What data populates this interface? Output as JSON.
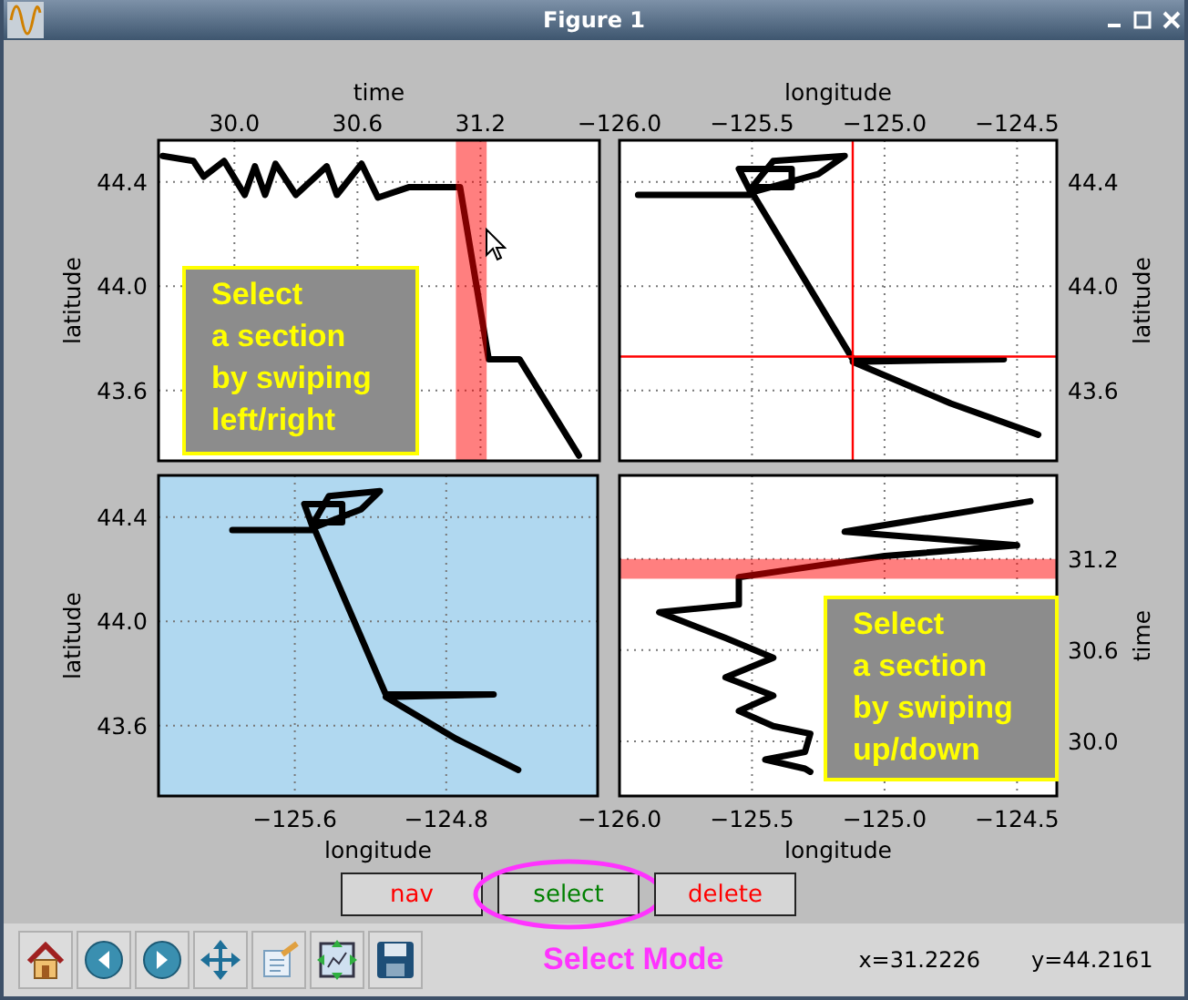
{
  "window": {
    "title": "Figure 1"
  },
  "axes": [
    {
      "highlighted": false,
      "hint": {
        "text": "Select\na section\nby swiping\nleft/right"
      },
      "chart_data": {
        "type": "line",
        "xlabel": "time",
        "ylabel": "latitude",
        "xlim": [
          29.63,
          31.78
        ],
        "ylim": [
          43.33,
          44.56
        ],
        "grid": true,
        "xticks": [
          {
            "value": 30.0,
            "label": "30.0"
          },
          {
            "value": 30.6,
            "label": "30.6"
          },
          {
            "value": 31.2,
            "label": "31.2"
          }
        ],
        "yticks": [
          {
            "value": 43.6,
            "label": "43.6"
          },
          {
            "value": 44.0,
            "label": "44.0"
          },
          {
            "value": 44.4,
            "label": "44.4"
          }
        ],
        "x": [
          29.65,
          29.8,
          29.85,
          29.95,
          30.05,
          30.1,
          30.15,
          30.2,
          30.3,
          30.45,
          30.5,
          30.62,
          30.7,
          30.85,
          31.1,
          31.24,
          31.39,
          31.68
        ],
        "series": [
          {
            "color": "#000000",
            "values": [
              44.5,
              44.48,
              44.42,
              44.48,
              44.35,
              44.46,
              44.35,
              44.47,
              44.35,
              44.46,
              44.35,
              44.47,
              44.34,
              44.38,
              44.38,
              43.72,
              43.72,
              43.35
            ]
          }
        ],
        "bands": [
          {
            "axis": "x",
            "from": 31.08,
            "to": 31.23,
            "color": "#ff0000"
          }
        ]
      }
    },
    {
      "highlighted": false,
      "chart_data": {
        "type": "line",
        "xlabel": "longitude",
        "ylabel": "latitude",
        "xlim": [
          -126.0,
          -124.35
        ],
        "ylim": [
          43.33,
          44.56
        ],
        "grid": true,
        "xticks": [
          {
            "value": -126.0,
            "label": "−126.0"
          },
          {
            "value": -125.5,
            "label": "−125.5"
          },
          {
            "value": -125.0,
            "label": "−125.0"
          },
          {
            "value": -124.5,
            "label": "−124.5"
          }
        ],
        "yticks": [
          {
            "value": 43.6,
            "label": "43.6"
          },
          {
            "value": 44.0,
            "label": "44.0"
          },
          {
            "value": 44.4,
            "label": "44.4"
          }
        ],
        "x": [
          -125.93,
          -125.5,
          -125.55,
          -125.35,
          -125.35,
          -125.5,
          -125.42,
          -125.15,
          -125.25,
          -125.5,
          -125.12,
          -124.55,
          -125.12,
          -124.75,
          -124.42
        ],
        "series": [
          {
            "color": "#000000",
            "values": [
              44.35,
              44.35,
              44.45,
              44.45,
              44.38,
              44.38,
              44.48,
              44.5,
              44.43,
              44.36,
              43.72,
              43.72,
              43.71,
              43.55,
              43.43
            ]
          }
        ],
        "ref_lines": [
          {
            "axis": "x",
            "value": -125.12,
            "color": "#ff0000"
          },
          {
            "axis": "y",
            "value": 43.73,
            "color": "#ff0000"
          }
        ]
      }
    },
    {
      "highlighted": true,
      "chart_data": {
        "type": "line",
        "xlabel": "longitude",
        "ylabel": "latitude",
        "xlim": [
          -126.32,
          -124.0
        ],
        "ylim": [
          43.33,
          44.56
        ],
        "grid": true,
        "xticks": [
          {
            "value": -125.6,
            "label": "−125.6"
          },
          {
            "value": -124.8,
            "label": "−124.8"
          }
        ],
        "yticks": [
          {
            "value": 43.6,
            "label": "43.6"
          },
          {
            "value": 44.0,
            "label": "44.0"
          },
          {
            "value": 44.4,
            "label": "44.4"
          }
        ],
        "x": [
          -125.93,
          -125.5,
          -125.55,
          -125.35,
          -125.35,
          -125.5,
          -125.42,
          -125.15,
          -125.25,
          -125.5,
          -125.12,
          -124.55,
          -125.12,
          -124.75,
          -124.42
        ],
        "series": [
          {
            "color": "#000000",
            "values": [
              44.35,
              44.35,
              44.45,
              44.45,
              44.38,
              44.38,
              44.48,
              44.5,
              44.43,
              44.36,
              43.72,
              43.72,
              43.71,
              43.55,
              43.43
            ]
          }
        ]
      }
    },
    {
      "highlighted": false,
      "hint": {
        "text": "Select\na section\nby swiping\nup/down"
      },
      "chart_data": {
        "type": "line",
        "xlabel": "longitude",
        "ylabel": "time",
        "xlim": [
          -126.0,
          -124.35
        ],
        "ylim": [
          29.64,
          31.75
        ],
        "grid": true,
        "xticks": [
          {
            "value": -126.0,
            "label": "−126.0"
          },
          {
            "value": -125.5,
            "label": "−125.5"
          },
          {
            "value": -125.0,
            "label": "−125.0"
          },
          {
            "value": -124.5,
            "label": "−124.5"
          }
        ],
        "yticks": [
          {
            "value": 30.0,
            "label": "30.0"
          },
          {
            "value": 30.6,
            "label": "30.6"
          },
          {
            "value": 31.2,
            "label": "31.2"
          }
        ],
        "x": [
          -125.28,
          -125.3,
          -125.45,
          -125.3,
          -125.28,
          -125.42,
          -125.55,
          -125.42,
          -125.6,
          -125.42,
          -125.6,
          -125.85,
          -125.55,
          -125.55,
          -125.0,
          -124.5,
          -125.15,
          -124.45
        ],
        "series": [
          {
            "color": "#000000",
            "values": [
              29.8,
              29.82,
              29.88,
              29.93,
              30.05,
              30.1,
              30.2,
              30.3,
              30.42,
              30.55,
              30.68,
              30.85,
              30.9,
              31.08,
              31.22,
              31.29,
              31.38,
              31.58
            ]
          }
        ],
        "bands": [
          {
            "axis": "y",
            "from": 31.07,
            "to": 31.2,
            "color": "#ff0000"
          }
        ]
      }
    }
  ],
  "buttons": [
    {
      "label": "nav",
      "color": "#ff0000",
      "selected": false
    },
    {
      "label": "select",
      "color": "#008000",
      "selected": true
    },
    {
      "label": "delete",
      "color": "#ff0000",
      "selected": false
    }
  ],
  "toolbar": {
    "mode": "Select Mode",
    "x_readout": "x=31.2226",
    "y_readout": "y=44.2161"
  }
}
